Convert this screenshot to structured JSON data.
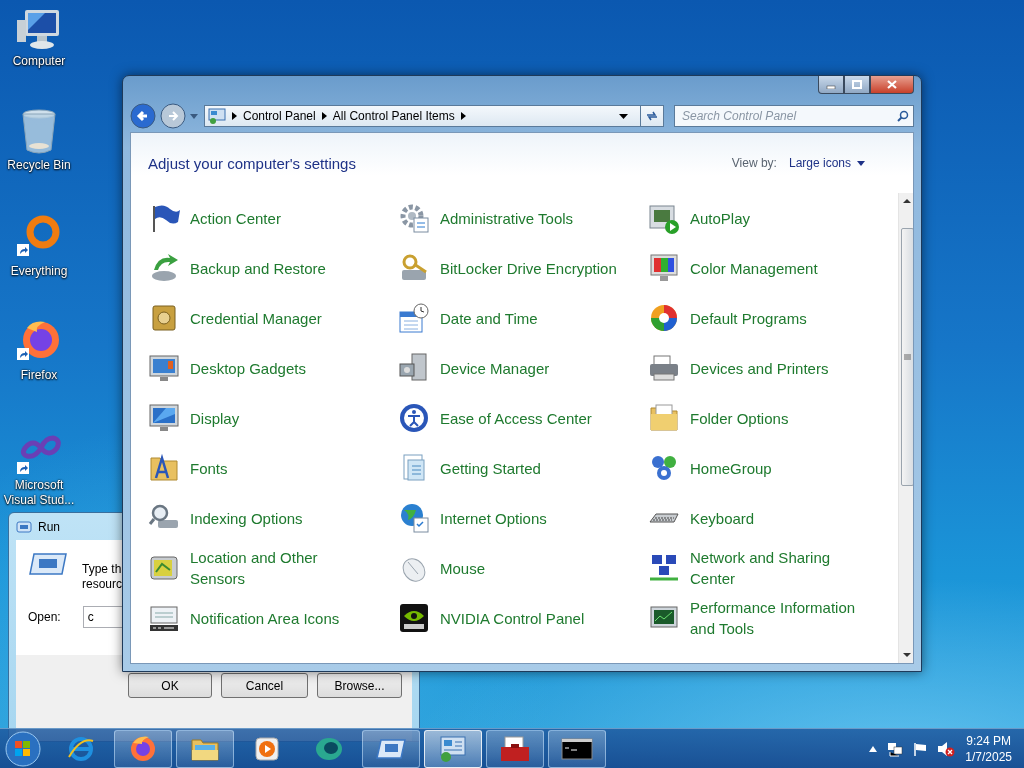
{
  "desktop_icons": [
    {
      "label": "Computer",
      "shortcut": false
    },
    {
      "label": "Recycle Bin",
      "shortcut": false
    },
    {
      "label": "Everything",
      "shortcut": true
    },
    {
      "label": "Firefox",
      "shortcut": true
    },
    {
      "label": "Microsoft Visual Stud...",
      "shortcut": true
    }
  ],
  "run_dialog": {
    "title": "Run",
    "prompt_lines": [
      "Type th",
      "resourc"
    ],
    "open_label": "Open:",
    "open_value": "c",
    "buttons": [
      "OK",
      "Cancel",
      "Browse..."
    ]
  },
  "control_panel": {
    "nav": {
      "back_enabled": true,
      "forward_enabled": false
    },
    "breadcrumbs": [
      "Control Panel",
      "All Control Panel Items"
    ],
    "search": {
      "placeholder": "Search Control Panel"
    },
    "heading": "Adjust your computer's settings",
    "view_by_label": "View by:",
    "view_by_value": "Large icons",
    "rows": [
      [
        {
          "label": "Action Center"
        },
        {
          "label": "Administrative Tools"
        },
        {
          "label": "AutoPlay"
        }
      ],
      [
        {
          "label": "Backup and Restore"
        },
        {
          "label": "BitLocker Drive Encryption"
        },
        {
          "label": "Color Management"
        }
      ],
      [
        {
          "label": "Credential Manager"
        },
        {
          "label": "Date and Time"
        },
        {
          "label": "Default Programs"
        }
      ],
      [
        {
          "label": "Desktop Gadgets"
        },
        {
          "label": "Device Manager"
        },
        {
          "label": "Devices and Printers"
        }
      ],
      [
        {
          "label": "Display"
        },
        {
          "label": "Ease of Access Center"
        },
        {
          "label": "Folder Options"
        }
      ],
      [
        {
          "label": "Fonts"
        },
        {
          "label": "Getting Started"
        },
        {
          "label": "HomeGroup"
        }
      ],
      [
        {
          "label": "Indexing Options"
        },
        {
          "label": "Internet Options"
        },
        {
          "label": "Keyboard"
        }
      ],
      [
        {
          "label": "Location and Other Sensors"
        },
        {
          "label": "Mouse"
        },
        {
          "label": "Network and Sharing Center"
        }
      ],
      [
        {
          "label": "Notification Area Icons"
        },
        {
          "label": "NVIDIA Control Panel"
        },
        {
          "label": "Performance Information and Tools"
        }
      ]
    ]
  },
  "taskbar": {
    "items": [
      {
        "kind": "ie",
        "running": false,
        "selected": false
      },
      {
        "kind": "firefox",
        "running": true,
        "selected": false
      },
      {
        "kind": "explorer",
        "running": true,
        "selected": false
      },
      {
        "kind": "media",
        "running": false,
        "selected": false
      },
      {
        "kind": "app",
        "running": false,
        "selected": false
      },
      {
        "kind": "run",
        "running": true,
        "selected": false
      },
      {
        "kind": "controlpanel",
        "running": true,
        "selected": true
      },
      {
        "kind": "toolbox",
        "running": true,
        "selected": false
      },
      {
        "kind": "cmd",
        "running": true,
        "selected": false
      }
    ],
    "volume_muted": true,
    "clock": {
      "time": "9:24 PM",
      "date": "1/7/2025"
    }
  }
}
